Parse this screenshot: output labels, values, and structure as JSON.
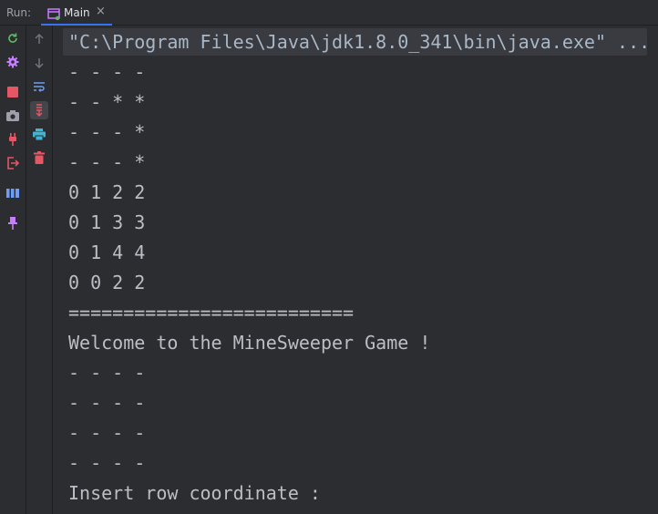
{
  "run_panel": {
    "label": "Run:",
    "tab": {
      "label": "Main",
      "close": "×"
    }
  },
  "toolbar_left": [
    {
      "name": "rerun-icon",
      "color": "#5fb865"
    },
    {
      "name": "settings-icon",
      "color": "#c77dff"
    },
    {
      "name": "stop-icon",
      "color": "#e55765"
    },
    {
      "name": "camera-icon",
      "color": "#9da0a8"
    },
    {
      "name": "plug-icon",
      "color": "#e55765"
    },
    {
      "name": "exit-icon",
      "color": "#e55765"
    },
    {
      "name": "layout-icon",
      "color": "#6d9ef7"
    },
    {
      "name": "pin-icon",
      "color": "#c77dff"
    }
  ],
  "toolbar_right": [
    {
      "name": "up-arrow-icon",
      "color": "#6f737a"
    },
    {
      "name": "down-arrow-icon",
      "color": "#6f737a"
    },
    {
      "name": "soft-wrap-icon",
      "color": "#6d9ef7"
    },
    {
      "name": "scroll-to-end-icon",
      "color": "#e55765"
    },
    {
      "name": "print-icon",
      "color": "#3fb6d6"
    },
    {
      "name": "trash-icon",
      "color": "#e55765"
    }
  ],
  "console": {
    "command": "\"C:\\Program Files\\Java\\jdk1.8.0_341\\bin\\java.exe\" ...",
    "lines": [
      "- - - -",
      "- - * *",
      "- - - *",
      "- - - *",
      "0 1 2 2",
      "0 1 3 3",
      "0 1 4 4",
      "0 0 2 2",
      "==========================",
      "Welcome to the MineSweeper Game !",
      "- - - -",
      "- - - -",
      "- - - -",
      "- - - -",
      "Insert row coordinate :"
    ]
  }
}
